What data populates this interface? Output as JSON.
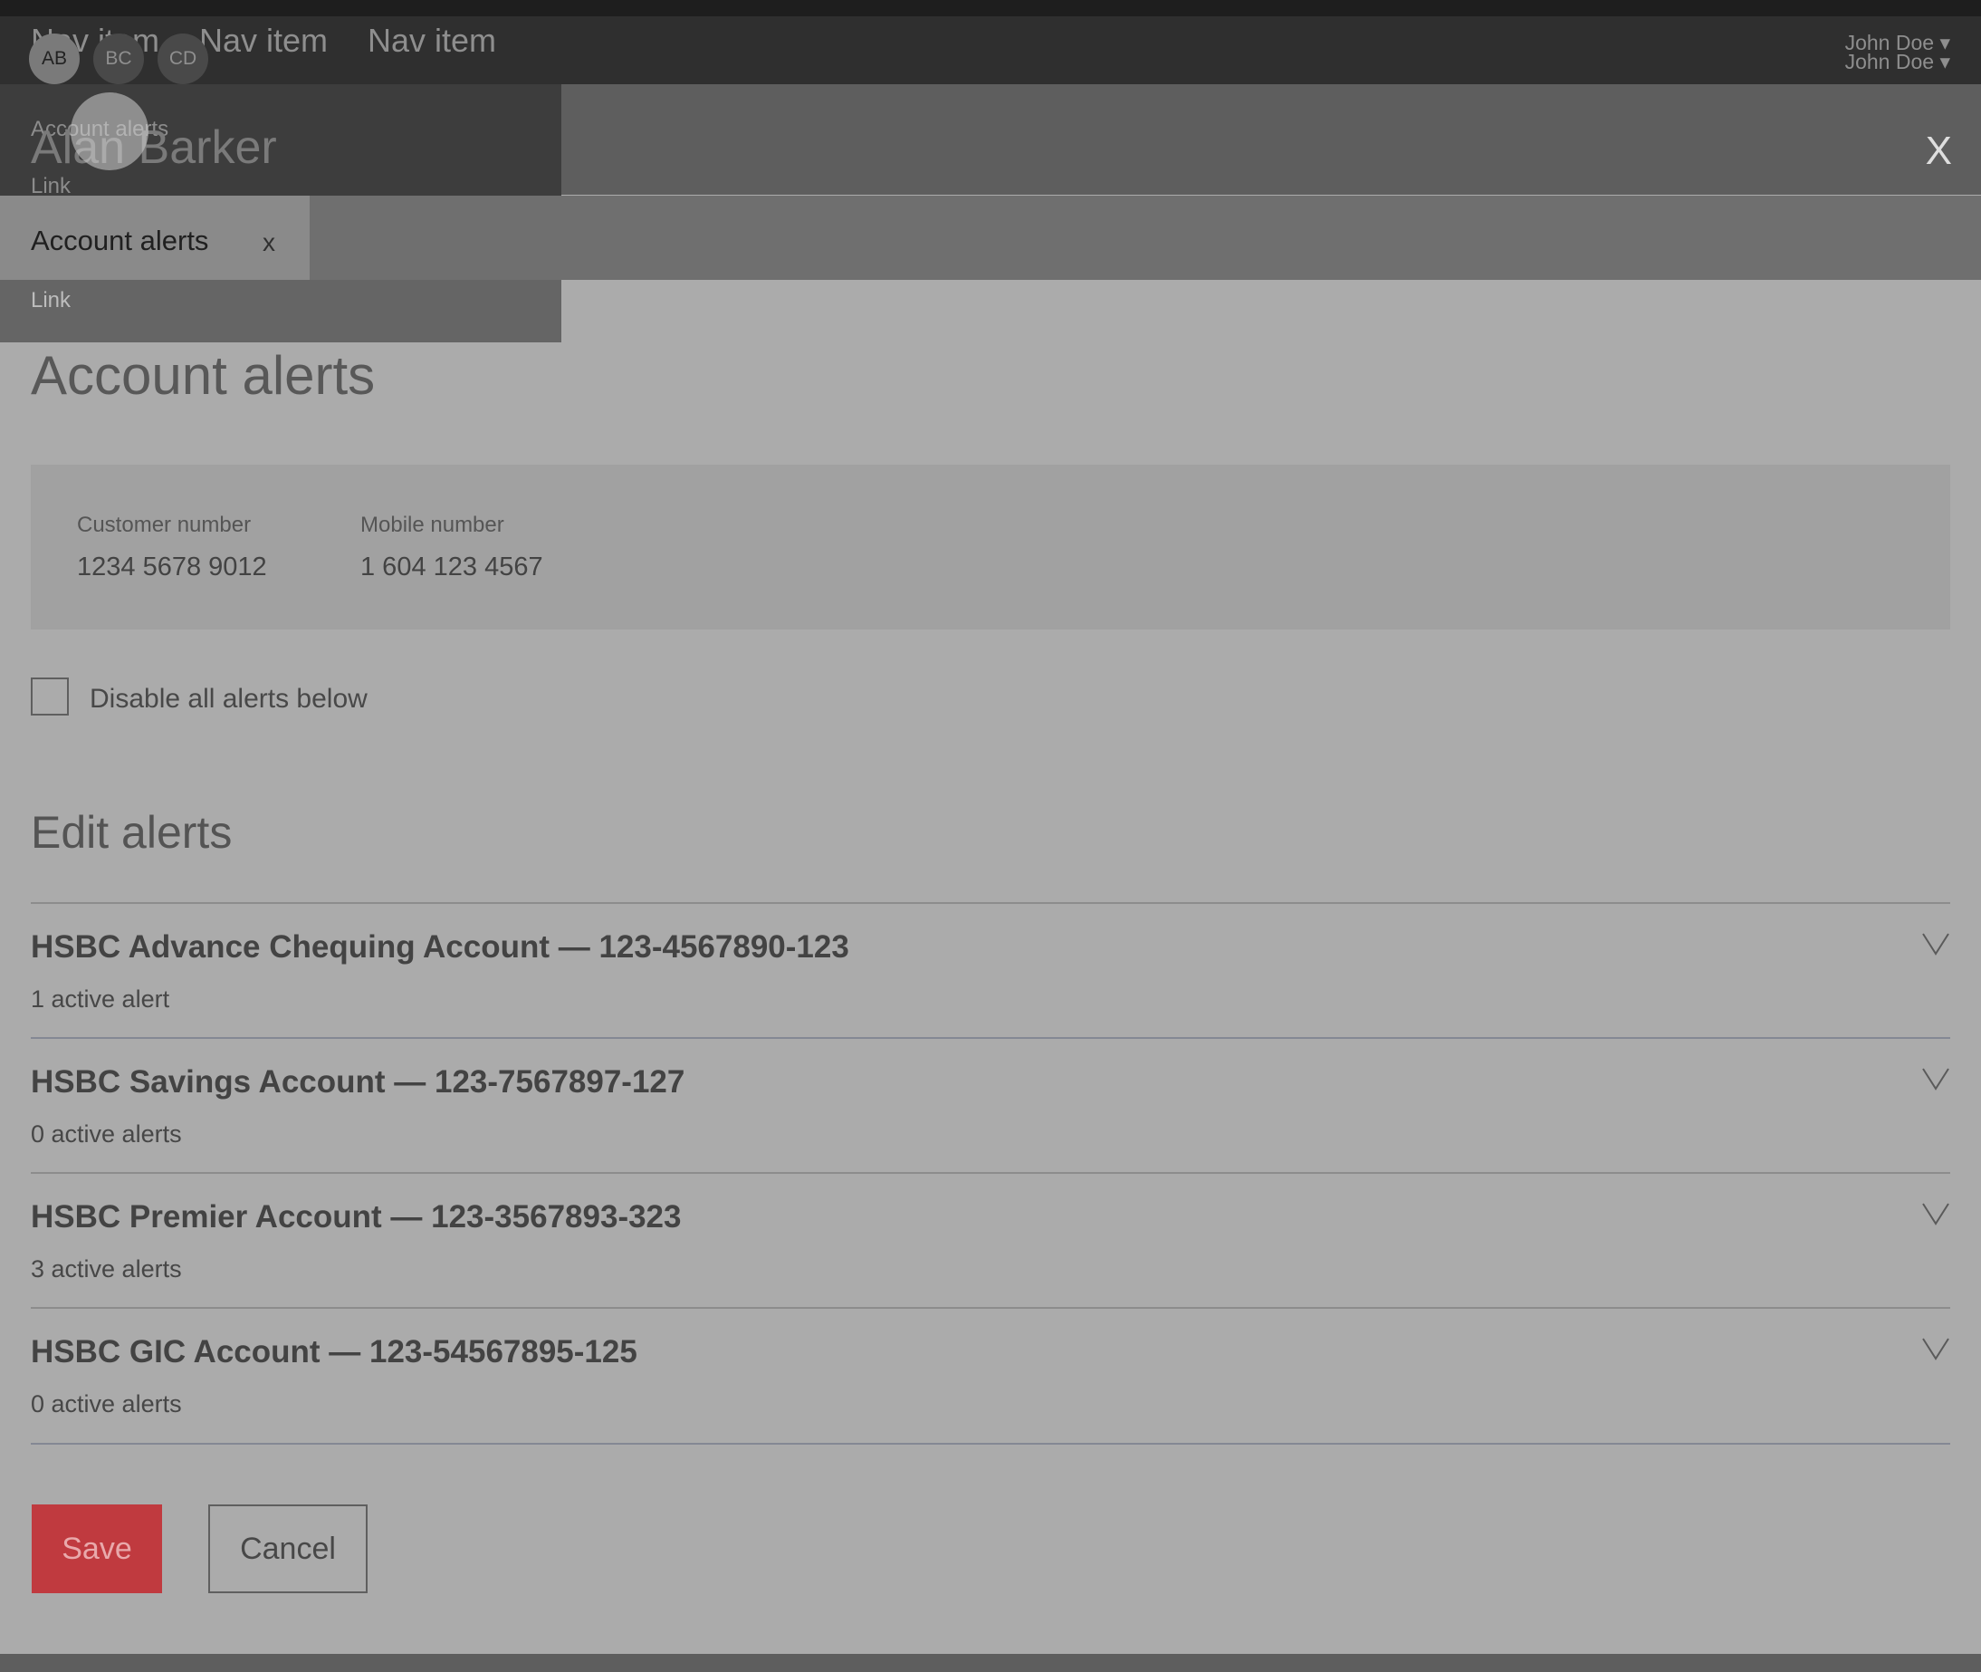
{
  "topnav": {
    "items": [
      "Nav item",
      "Nav item",
      "Nav item"
    ],
    "user_lines": [
      "John Doe ▾",
      "John Doe ▾"
    ]
  },
  "avatars": [
    "AB",
    "BC",
    "CD"
  ],
  "flyout": {
    "heading": "Account alerts",
    "links": [
      "Link",
      "Link"
    ],
    "partial_text": "Acc"
  },
  "header": {
    "customer_name": "Alan Barker",
    "close_label": "X"
  },
  "tab": {
    "label": "Account alerts",
    "close_label": "x"
  },
  "page": {
    "title": "Account alerts",
    "customer_number_label": "Customer number",
    "customer_number_value": "1234 5678 9012",
    "mobile_number_label": "Mobile number",
    "mobile_number_value": "1 604 123 4567",
    "disable_all_label": "Disable all alerts below",
    "edit_section_title": "Edit alerts"
  },
  "accounts": [
    {
      "title": "HSBC Advance Chequing Account — 123-4567890-123",
      "alerts": "1 active alert"
    },
    {
      "title": "HSBC Savings Account — 123-7567897-127",
      "alerts": "0 active alerts"
    },
    {
      "title": "HSBC Premier Account — 123-3567893-323",
      "alerts": "3 active alerts"
    },
    {
      "title": "HSBC GIC Account — 123-54567895-125",
      "alerts": "0 active alerts"
    }
  ],
  "actions": {
    "save_label": "Save",
    "cancel_label": "Cancel"
  },
  "colors": {
    "primary": "#c03a3f",
    "overlay_gray": "#ababab"
  }
}
